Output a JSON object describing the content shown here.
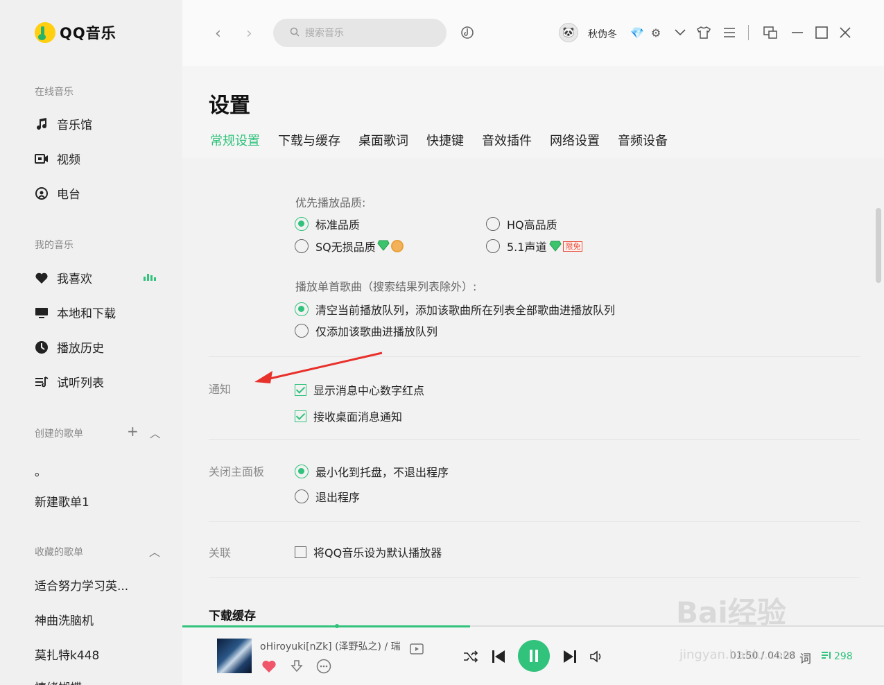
{
  "app": {
    "name": "QQ音乐"
  },
  "sidebar": {
    "online_title": "在线音乐",
    "online_items": [
      {
        "label": "音乐馆",
        "icon": "music-note-icon"
      },
      {
        "label": "视频",
        "icon": "video-icon"
      },
      {
        "label": "电台",
        "icon": "radio-icon"
      }
    ],
    "my_title": "我的音乐",
    "my_items": [
      {
        "label": "我喜欢",
        "icon": "heart-icon"
      },
      {
        "label": "本地和下载",
        "icon": "monitor-icon"
      },
      {
        "label": "播放历史",
        "icon": "clock-icon"
      },
      {
        "label": "试听列表",
        "icon": "playlist-icon"
      }
    ],
    "created_title": "创建的歌单",
    "created_items": [
      "。",
      "新建歌单1"
    ],
    "collected_title": "收藏的歌单",
    "collected_items": [
      "适合努力学习英...",
      "神曲洗脑机",
      "莫扎特k448",
      "情绪蝴蝶"
    ]
  },
  "topbar": {
    "search_placeholder": "搜索音乐",
    "username": "秋伪冬"
  },
  "settings": {
    "title": "设置",
    "tabs": [
      "常规设置",
      "下载与缓存",
      "桌面歌词",
      "快捷键",
      "音效插件",
      "网络设置",
      "音频设备"
    ],
    "active_tab": 0,
    "quality": {
      "title": "优先播放品质:",
      "options": [
        {
          "label": "标准品质",
          "selected": true
        },
        {
          "label": "HQ高品质",
          "selected": false
        },
        {
          "label": "SQ无损品质",
          "selected": false
        },
        {
          "label": "5.1声道",
          "selected": false,
          "badge": "限免"
        }
      ]
    },
    "playlist": {
      "title": "播放单首歌曲（搜索结果列表除外）:",
      "options": [
        {
          "label": "清空当前播放队列，添加该歌曲所在列表全部歌曲进播放队列",
          "selected": true
        },
        {
          "label": "仅添加该歌曲进播放队列",
          "selected": false
        }
      ]
    },
    "notify": {
      "label": "通知",
      "options": [
        {
          "label": "显示消息中心数字红点",
          "checked": true
        },
        {
          "label": "接收桌面消息通知",
          "checked": true
        }
      ]
    },
    "close_panel": {
      "label": "关闭主面板",
      "options": [
        {
          "label": "最小化到托盘，不退出程序",
          "selected": true
        },
        {
          "label": "退出程序",
          "selected": false
        }
      ]
    },
    "assoc": {
      "label": "关联",
      "options": [
        {
          "label": "将QQ音乐设为默认播放器",
          "checked": false
        }
      ]
    },
    "next_section": "下载缓存"
  },
  "player": {
    "song": "oHiroyuki[nZk] (泽野弘之) / 瑞",
    "time": "01:50 / 04:28",
    "lyric": "词",
    "count": "298",
    "progress": 0.41
  },
  "watermark": {
    "brand": "Bai经验",
    "url": "jingyan.baidu.com"
  },
  "colors": {
    "accent": "#31c27c",
    "arrow": "#e8312a"
  }
}
